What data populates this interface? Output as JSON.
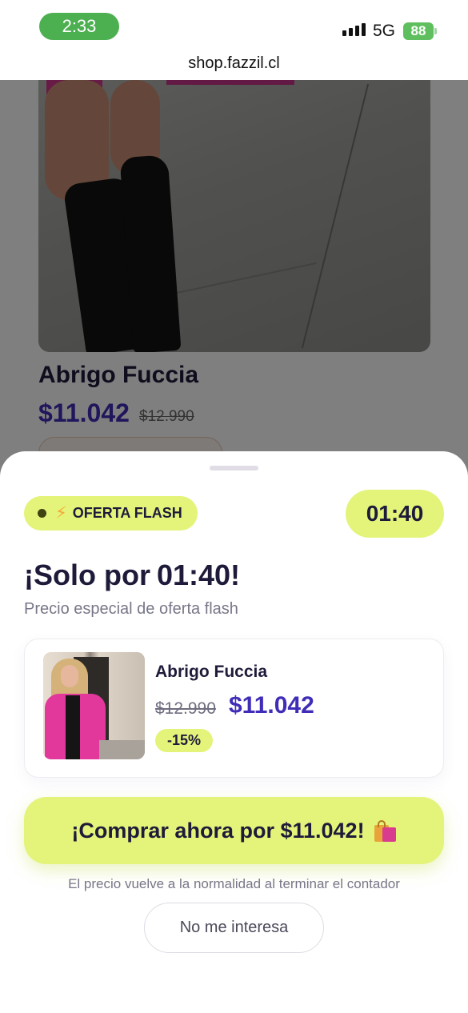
{
  "status_bar": {
    "time": "2:33",
    "network": "5G",
    "battery": "88",
    "url": "shop.fazzil.cl"
  },
  "background_product": {
    "title": "Abrigo Fuccia",
    "price": "$11.042",
    "old_price": "$12.990"
  },
  "flash_sheet": {
    "badge_label": "OFERTA FLASH",
    "timer": "01:40",
    "headline_prefix": "¡Solo por",
    "headline_time": "01:40!",
    "subtitle": "Precio especial de oferta flash",
    "product": {
      "name": "Abrigo Fuccia",
      "old_price": "$12.990",
      "price": "$11.042",
      "discount": "-15%"
    },
    "cta_label": "¡Comprar ahora por $11.042!",
    "note": "El precio vuelve a la normalidad al terminar el contador",
    "decline_label": "No me interesa"
  },
  "colors": {
    "accent_lime": "#e4f47a",
    "price_purple": "#3f2db8",
    "time_pill_green": "#4caf50"
  },
  "icons": [
    "signal-icon",
    "battery-icon",
    "lightning-icon",
    "shopping-bags-icon"
  ]
}
